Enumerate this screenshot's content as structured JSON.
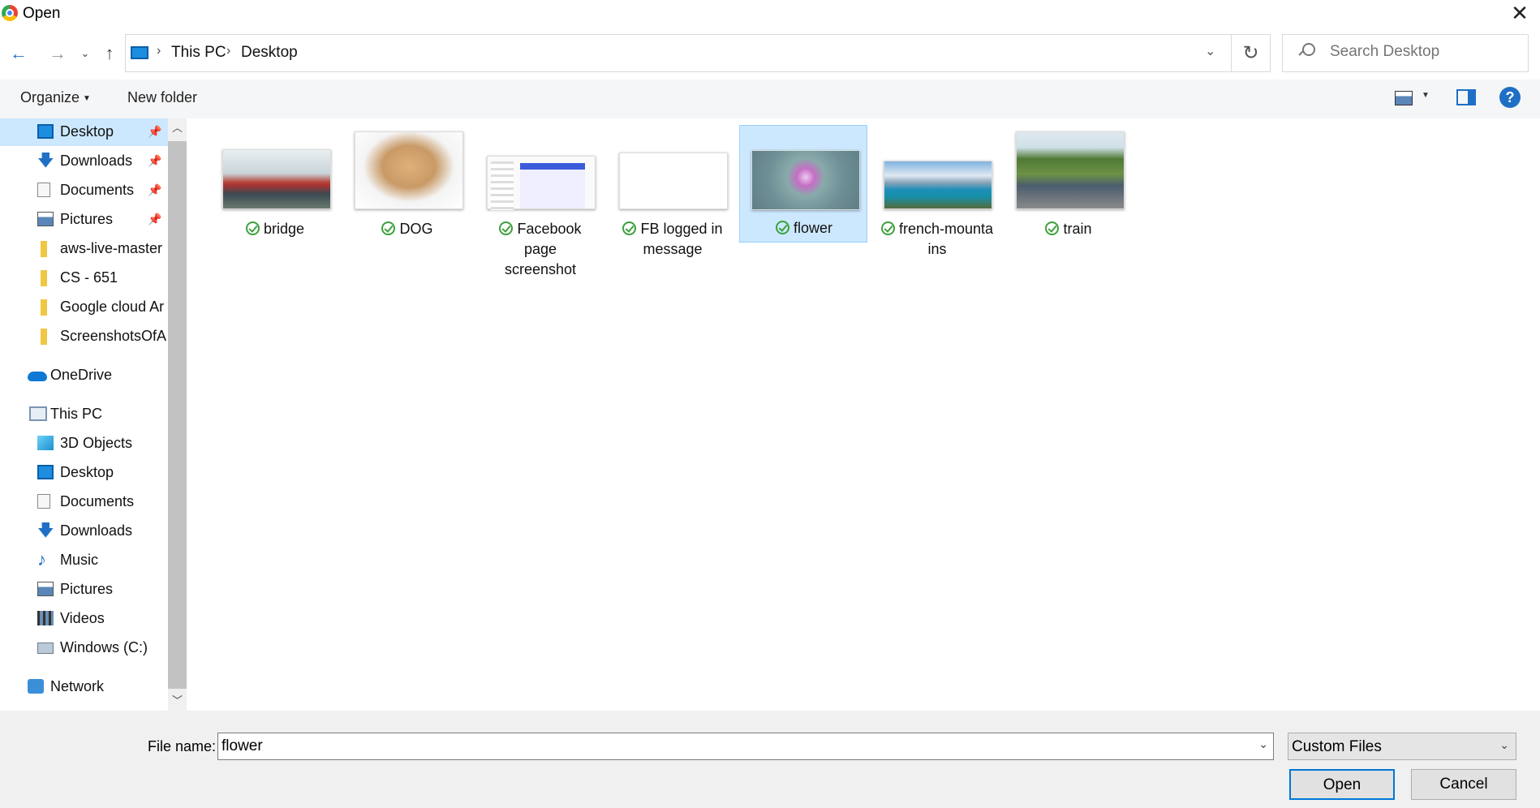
{
  "window": {
    "title": "Open",
    "close_glyph": "✕"
  },
  "nav": {
    "back": "←",
    "forward": "→",
    "recent": "⌄",
    "up": "↑",
    "refresh": "↻",
    "addr_dropdown": "⌄",
    "breadcrumb_sep": "›"
  },
  "address": {
    "crumbs": [
      "This PC",
      "Desktop"
    ]
  },
  "search": {
    "placeholder": "Search Desktop"
  },
  "toolbar": {
    "organize": "Organize",
    "new_folder": "New folder",
    "help": "?"
  },
  "sidebar": {
    "items": [
      {
        "label": "Desktop",
        "icon": "desktop-icon",
        "pinned": true,
        "selected": true
      },
      {
        "label": "Downloads",
        "icon": "download-icon",
        "pinned": true
      },
      {
        "label": "Documents",
        "icon": "documents-icon",
        "pinned": true
      },
      {
        "label": "Pictures",
        "icon": "pictures-icon",
        "pinned": true
      },
      {
        "label": "aws-live-master",
        "icon": "folder-icon"
      },
      {
        "label": "CS - 651",
        "icon": "folder-icon"
      },
      {
        "label": "Google cloud Ar",
        "icon": "folder-icon"
      },
      {
        "label": "ScreenshotsOfAp",
        "icon": "folder-icon"
      },
      {
        "label": "OneDrive",
        "icon": "onedrive-icon"
      },
      {
        "label": "This PC",
        "icon": "this-pc-icon"
      },
      {
        "label": "3D Objects",
        "icon": "3d-objects-icon"
      },
      {
        "label": "Desktop",
        "icon": "desktop-icon"
      },
      {
        "label": "Documents",
        "icon": "documents-icon"
      },
      {
        "label": "Downloads",
        "icon": "download-icon"
      },
      {
        "label": "Music",
        "icon": "music-icon"
      },
      {
        "label": "Pictures",
        "icon": "pictures-icon"
      },
      {
        "label": "Videos",
        "icon": "videos-icon"
      },
      {
        "label": "Windows (C:)",
        "icon": "drive-icon"
      },
      {
        "label": "Network",
        "icon": "network-icon"
      }
    ]
  },
  "files": [
    {
      "name": "bridge"
    },
    {
      "name": "DOG"
    },
    {
      "name": "Facebook page screenshot"
    },
    {
      "name": "FB logged in message"
    },
    {
      "name": "flower",
      "selected": true
    },
    {
      "name": "french-mountains"
    },
    {
      "name": "train"
    }
  ],
  "footer": {
    "file_name_label": "File name:",
    "file_name_value": "flower",
    "file_type": "Custom Files",
    "open_label": "Open",
    "cancel_label": "Cancel"
  },
  "colors": {
    "accent": "#0078d7",
    "selection": "#cce8ff",
    "sync_check": "#3ca03c"
  }
}
